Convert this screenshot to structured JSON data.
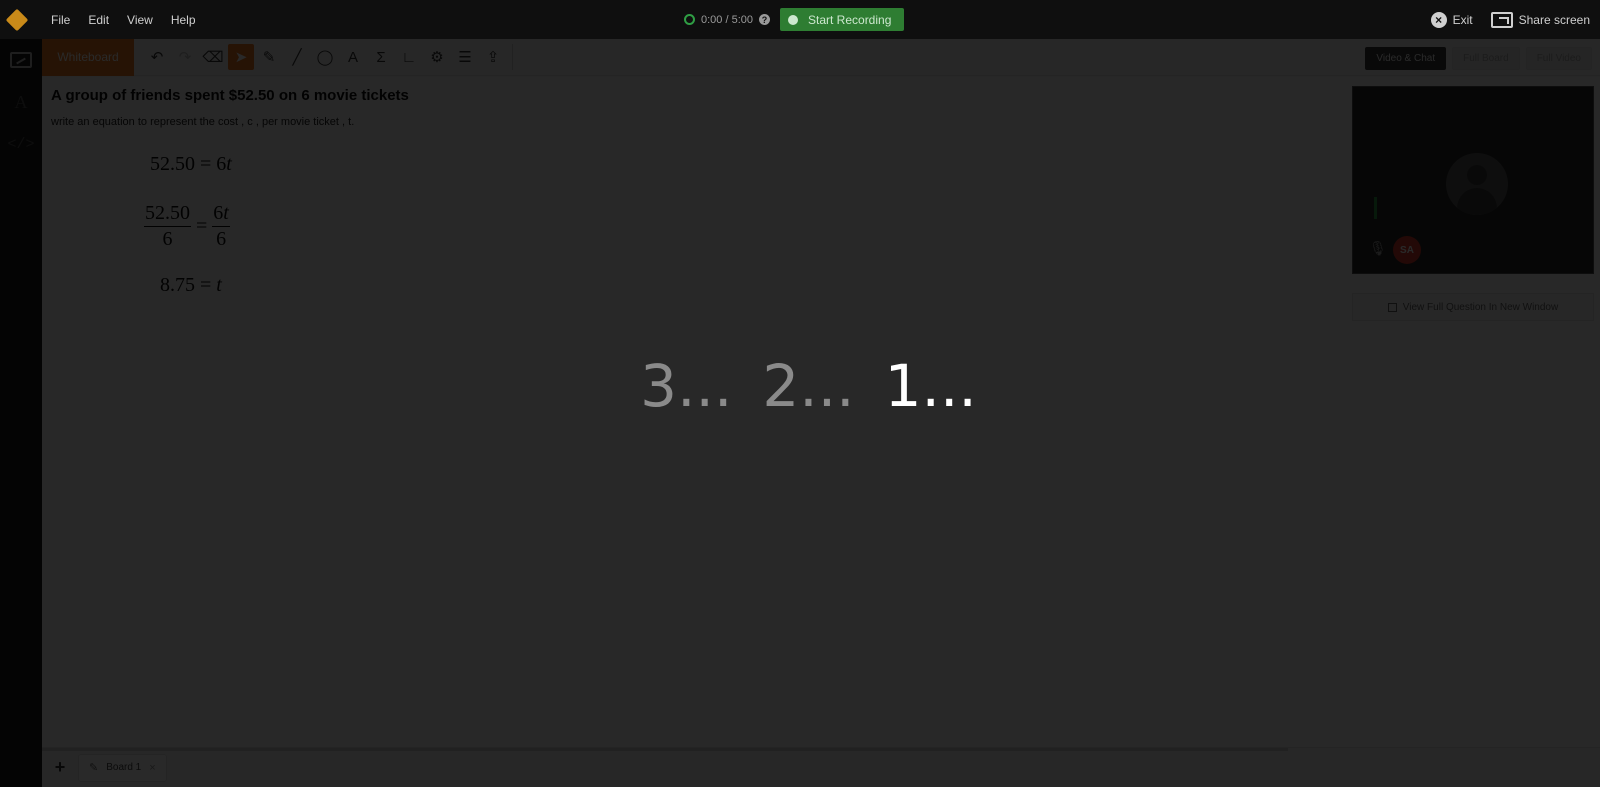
{
  "menubar": {
    "items": [
      "File",
      "Edit",
      "View",
      "Help"
    ],
    "timer": "0:00 / 5:00",
    "record_label": "Start Recording",
    "exit_label": "Exit",
    "share_label": "Share screen"
  },
  "toolbar": {
    "whiteboard_tab": "Whiteboard",
    "view_buttons": [
      "Video & Chat",
      "Full Board",
      "Full Video"
    ],
    "tools": [
      "undo-icon",
      "redo-icon",
      "eraser-icon",
      "select-cursor-icon",
      "pen-icon",
      "line-icon",
      "shape-icon",
      "text-icon",
      "sigma-icon",
      "graph-axes-icon",
      "settings-gear-icon",
      "layers-icon",
      "upload-icon"
    ]
  },
  "question": {
    "title": "A group of friends spent $52.50 on 6 movie tickets",
    "subtitle": "write an equation to represent the cost , c , per movie ticket , t.",
    "eq1_left": "52.50",
    "eq1_eq": "=",
    "eq1_coef": "6",
    "eq1_var": "t",
    "eq2_num_left": "52.50",
    "eq2_den_left": "6",
    "eq2_eq": "=",
    "eq2_num_right_coef": "6",
    "eq2_num_right_var": "t",
    "eq2_den_right": "6",
    "eq3_left": "8.75",
    "eq3_eq": "=",
    "eq3_var": "t"
  },
  "video_panel": {
    "user_initials": "SA",
    "full_question_label": "View Full Question In New Window"
  },
  "boards": {
    "tabs": [
      "Board 1"
    ]
  },
  "countdown": {
    "three": "3...",
    "two": "2...",
    "one": "1..."
  },
  "colors": {
    "accent": "#e8761f",
    "record_green": "#2e7d32",
    "user_badge": "#d93a2b"
  }
}
